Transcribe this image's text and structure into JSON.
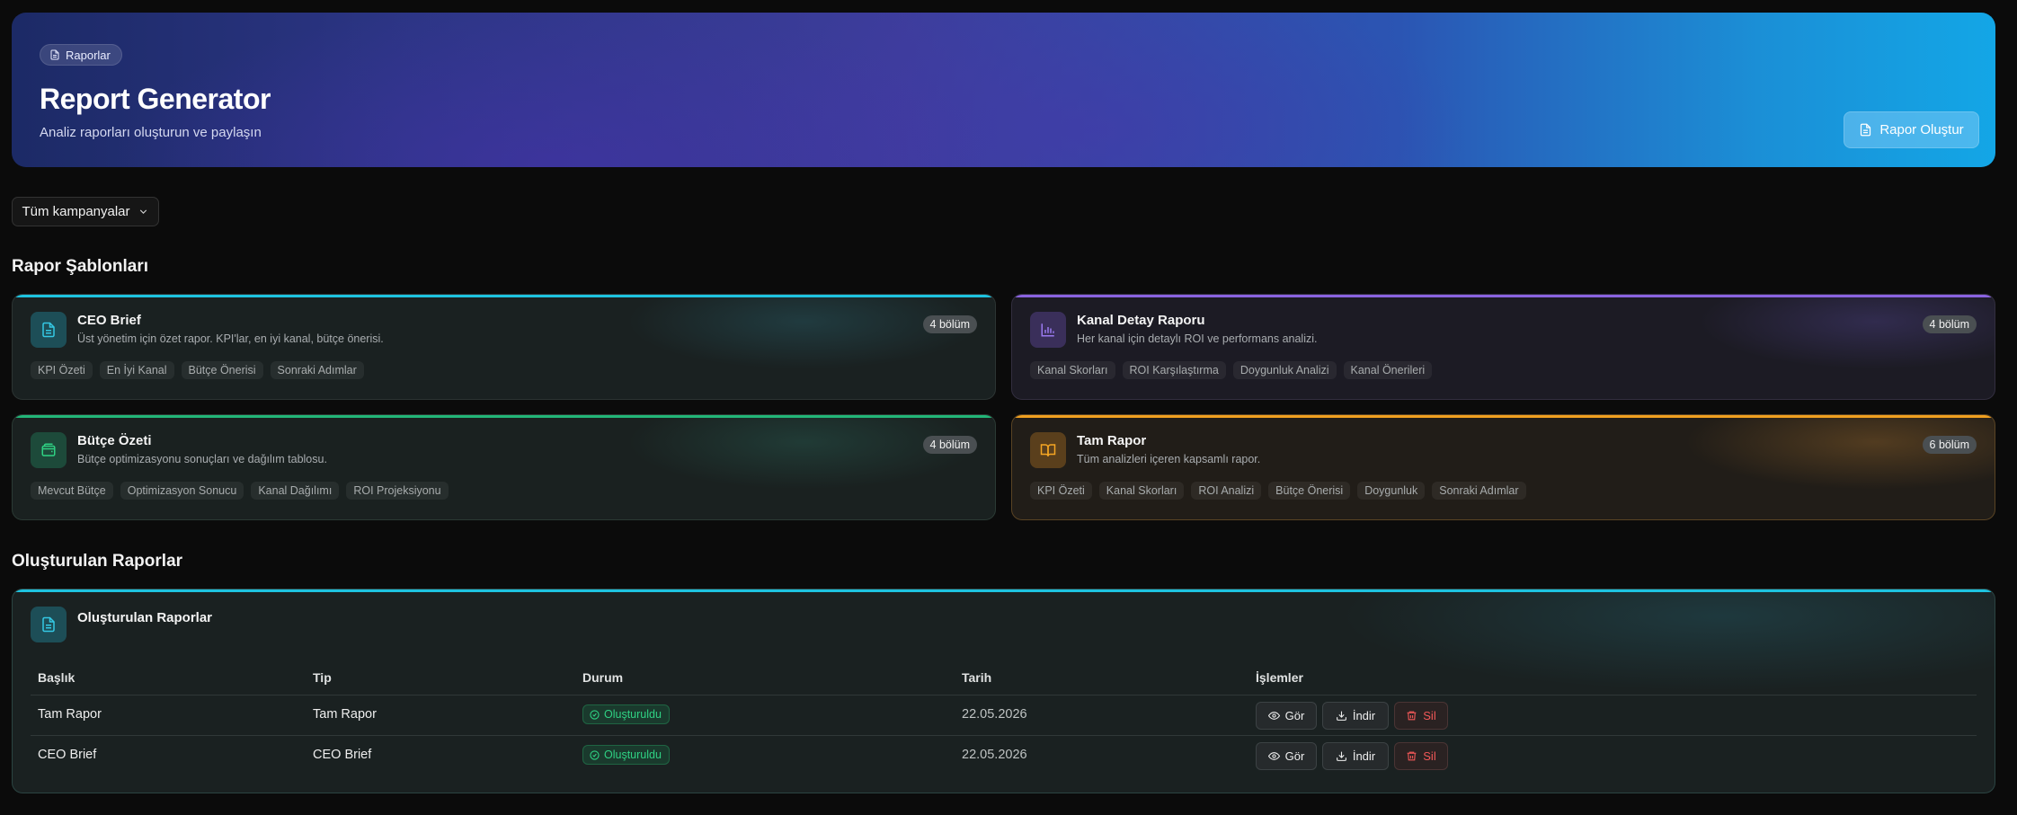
{
  "hero": {
    "chip_label": "Raporlar",
    "title": "Report Generator",
    "subtitle": "Analiz raporları oluşturun ve paylaşın",
    "create_button": "Rapor Oluştur",
    "gradient_colors": [
      "#1c2a66",
      "#3d3d9c",
      "#13a6e6"
    ]
  },
  "filter": {
    "selected": "Tüm kampanyalar"
  },
  "templates_section": {
    "title": "Rapor Şablonları",
    "cards": [
      {
        "title": "CEO Brief",
        "description": "Üst yönetim için özet rapor. KPI'lar, en iyi kanal, bütçe önerisi.",
        "badge": "4 bölüm",
        "icon": "document-icon",
        "accent": "#1ec3e0",
        "tags": [
          "KPI Özeti",
          "En İyi Kanal",
          "Bütçe Önerisi",
          "Sonraki Adımlar"
        ]
      },
      {
        "title": "Kanal Detay Raporu",
        "description": "Her kanal için detaylı ROI ve performans analizi.",
        "badge": "4 bölüm",
        "icon": "bar-chart-icon",
        "accent": "#8a63e0",
        "tags": [
          "Kanal Skorları",
          "ROI Karşılaştırma",
          "Doygunluk Analizi",
          "Kanal Önerileri"
        ]
      },
      {
        "title": "Bütçe Özeti",
        "description": "Bütçe optimizasyonu sonuçları ve dağılım tablosu.",
        "badge": "4 bölüm",
        "icon": "wallet-icon",
        "accent": "#22b678",
        "tags": [
          "Mevcut Bütçe",
          "Optimizasyon Sonucu",
          "Kanal Dağılımı",
          "ROI Projeksiyonu"
        ]
      },
      {
        "title": "Tam Rapor",
        "description": "Tüm analizleri içeren kapsamlı rapor.",
        "badge": "6 bölüm",
        "icon": "book-icon",
        "accent": "#f0a020",
        "tags": [
          "KPI Özeti",
          "Kanal Skorları",
          "ROI Analizi",
          "Bütçe Önerisi",
          "Doygunluk",
          "Sonraki Adımlar"
        ]
      }
    ]
  },
  "reports_section": {
    "title": "Oluşturulan Raporlar",
    "panel_title": "Oluşturulan Raporlar",
    "columns": [
      "Başlık",
      "Tip",
      "Durum",
      "Tarih",
      "İşlemler"
    ],
    "rows": [
      {
        "title": "Tam Rapor",
        "type": "Tam Rapor",
        "status": "Oluşturuldu",
        "date": "22.05.2026"
      },
      {
        "title": "CEO Brief",
        "type": "CEO Brief",
        "status": "Oluşturuldu",
        "date": "22.05.2026"
      }
    ],
    "actions": {
      "view": "Gör",
      "download": "İndir",
      "delete": "Sil"
    }
  }
}
